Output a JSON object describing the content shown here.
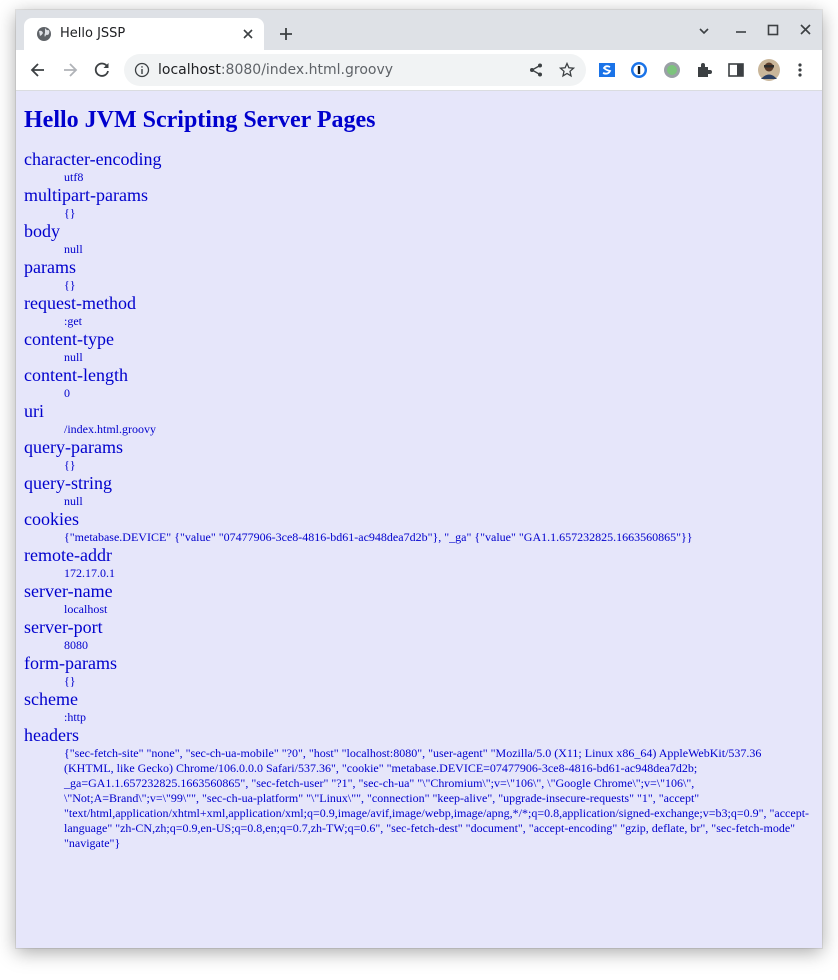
{
  "browser": {
    "tab": {
      "title": "Hello JSSP"
    },
    "url": {
      "host": "localhost",
      "rest": ":8080/index.html.groovy"
    }
  },
  "page": {
    "title": "Hello JVM Scripting Server Pages",
    "entries": [
      {
        "key": "character-encoding",
        "value": "utf8"
      },
      {
        "key": "multipart-params",
        "value": "{}"
      },
      {
        "key": "body",
        "value": "null"
      },
      {
        "key": "params",
        "value": "{}"
      },
      {
        "key": "request-method",
        "value": ":get"
      },
      {
        "key": "content-type",
        "value": "null"
      },
      {
        "key": "content-length",
        "value": "0"
      },
      {
        "key": "uri",
        "value": "/index.html.groovy"
      },
      {
        "key": "query-params",
        "value": "{}"
      },
      {
        "key": "query-string",
        "value": "null"
      },
      {
        "key": "cookies",
        "value": "{\"metabase.DEVICE\" {\"value\" \"07477906-3ce8-4816-bd61-ac948dea7d2b\"}, \"_ga\" {\"value\" \"GA1.1.657232825.1663560865\"}}"
      },
      {
        "key": "remote-addr",
        "value": "172.17.0.1"
      },
      {
        "key": "server-name",
        "value": "localhost"
      },
      {
        "key": "server-port",
        "value": "8080"
      },
      {
        "key": "form-params",
        "value": "{}"
      },
      {
        "key": "scheme",
        "value": ":http"
      },
      {
        "key": "headers",
        "value": "{\"sec-fetch-site\" \"none\", \"sec-ch-ua-mobile\" \"?0\", \"host\" \"localhost:8080\", \"user-agent\" \"Mozilla/5.0 (X11; Linux x86_64) AppleWebKit/537.36 (KHTML, like Gecko) Chrome/106.0.0.0 Safari/537.36\", \"cookie\" \"metabase.DEVICE=07477906-3ce8-4816-bd61-ac948dea7d2b; _ga=GA1.1.657232825.1663560865\", \"sec-fetch-user\" \"?1\", \"sec-ch-ua\" \"\\\"Chromium\\\";v=\\\"106\\\", \\\"Google Chrome\\\";v=\\\"106\\\", \\\"Not;A=Brand\\\";v=\\\"99\\\"\", \"sec-ch-ua-platform\" \"\\\"Linux\\\"\", \"connection\" \"keep-alive\", \"upgrade-insecure-requests\" \"1\", \"accept\" \"text/html,application/xhtml+xml,application/xml;q=0.9,image/avif,image/webp,image/apng,*/*;q=0.8,application/signed-exchange;v=b3;q=0.9\", \"accept-language\" \"zh-CN,zh;q=0.9,en-US;q=0.8,en;q=0.7,zh-TW;q=0.6\", \"sec-fetch-dest\" \"document\", \"accept-encoding\" \"gzip, deflate, br\", \"sec-fetch-mode\" \"navigate\"}"
      }
    ]
  },
  "colors": {
    "page_background": "#e6e6fa",
    "text": "#0000cd",
    "tabstrip": "#dee1e6",
    "omnibox": "#f1f3f4"
  },
  "icons": {
    "tab_favicon": "globe-icon",
    "tab_close": "close-icon",
    "new_tab": "plus-icon",
    "tab_search": "chevron-down-icon",
    "minimize": "minimize-icon",
    "maximize": "maximize-icon",
    "window_close": "close-icon",
    "back": "back-arrow-icon",
    "forward": "forward-arrow-icon",
    "reload": "reload-icon",
    "site_info": "info-icon",
    "share": "share-icon",
    "bookmark": "star-icon",
    "extensions": [
      "s-extension-icon",
      "password-manager-icon",
      "circle-extension-icon",
      "puzzle-icon"
    ],
    "side_panel": "side-panel-icon",
    "profile": "avatar",
    "menu": "kebab-menu-icon"
  }
}
